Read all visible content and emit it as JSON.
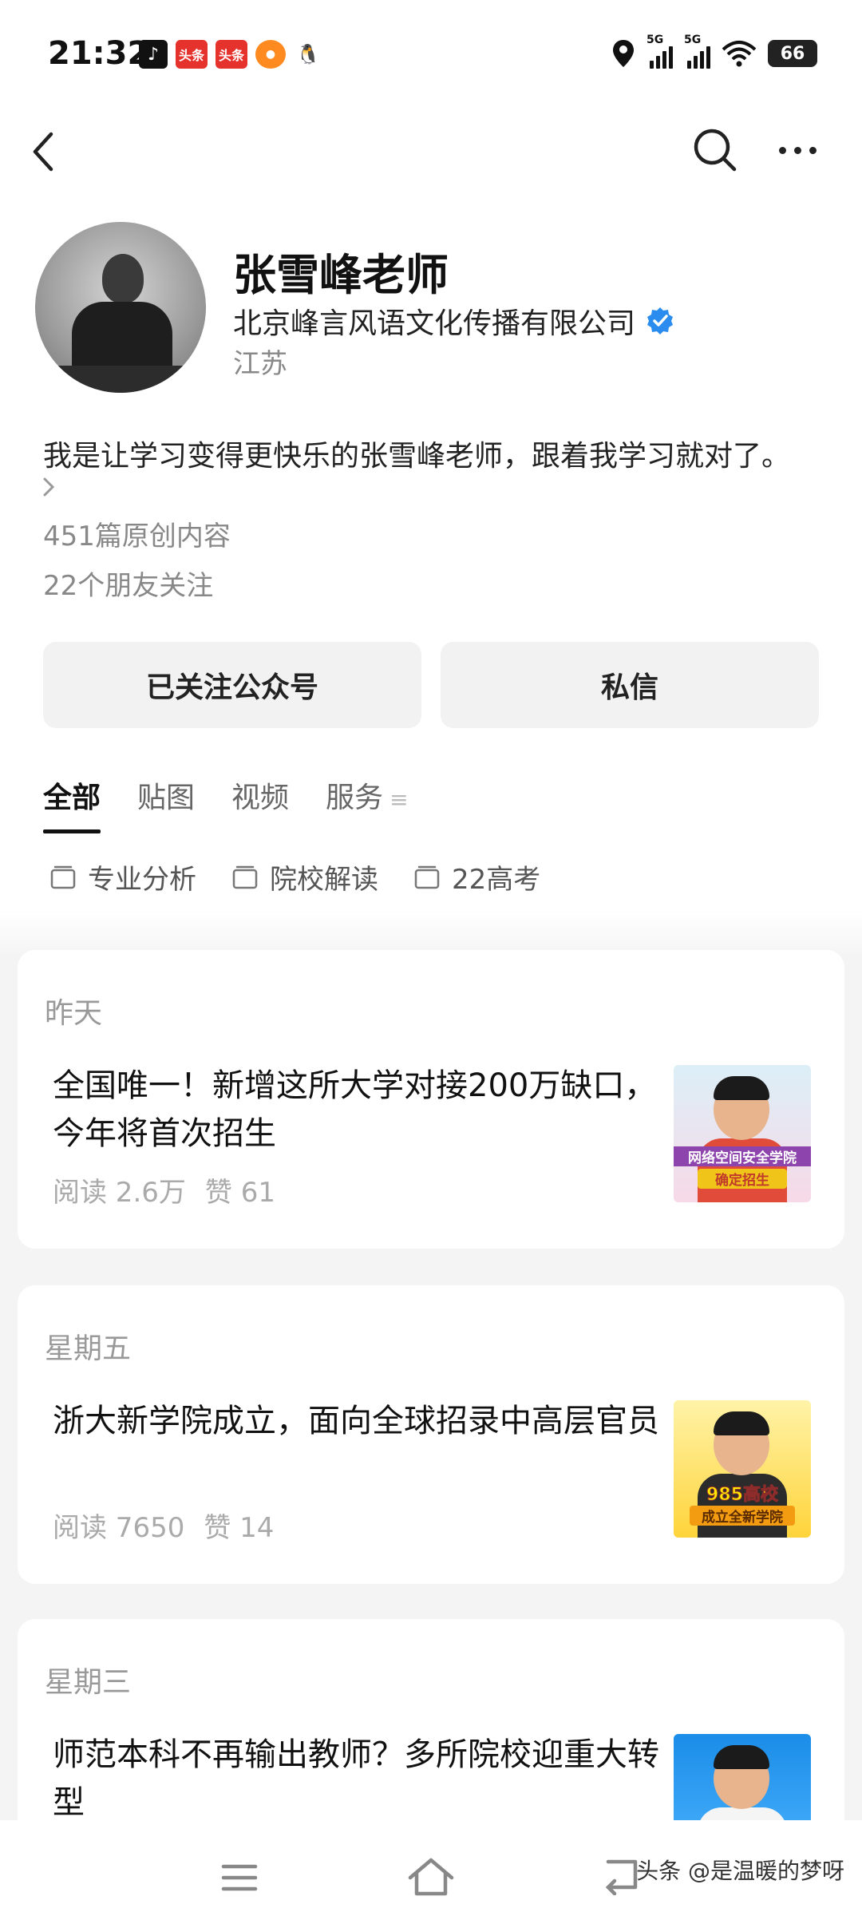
{
  "status_bar": {
    "time": "21:32",
    "apps": [
      "tiktok-icon",
      "toutiao-icon",
      "toutiao-icon",
      "orange-app-icon",
      "qq-icon"
    ],
    "app_label_toutiao": "头条",
    "network_label_1": "5G",
    "network_label_2": "5G",
    "battery": "66"
  },
  "nav": {
    "back_icon": "back-arrow-icon",
    "search_icon": "search-icon",
    "more_icon": "more-dots-icon"
  },
  "profile": {
    "name": "张雪峰老师",
    "organization": "北京峰言风语文化传播有限公司",
    "location": "江苏",
    "bio": "我是让学习变得更快乐的张雪峰老师，跟着我学习就对了。",
    "original_count": "451篇原创内容",
    "friends_following": "22个朋友关注",
    "verified_color": "#2b8cf0"
  },
  "actions": {
    "follow_label": "已关注公众号",
    "message_label": "私信"
  },
  "tabs": [
    {
      "label": "全部",
      "active": true
    },
    {
      "label": "贴图",
      "active": false
    },
    {
      "label": "视频",
      "active": false
    },
    {
      "label": "服务",
      "active": false
    }
  ],
  "collections": [
    "专业分析",
    "院校解读",
    "22高考"
  ],
  "articles": [
    {
      "date": "昨天",
      "title": "全国唯一！新增这所大学对接200万缺口，今年将首次招生",
      "reads": "阅读 2.6万",
      "likes": "赞 61",
      "thumb_caption_1": "网络空间安全学院",
      "thumb_caption_2": "确定招生"
    },
    {
      "date": "星期五",
      "title": "浙大新学院成立，面向全球招录中高层官员",
      "reads": "阅读 7650",
      "likes": "赞 14",
      "thumb_caption_1": "985高校",
      "thumb_caption_2": "成立全新学院"
    },
    {
      "date": "星期三",
      "title": "师范本科不再输出教师？多所院校迎重大转型"
    }
  ],
  "watermark": "头条 @是温暖的梦呀"
}
